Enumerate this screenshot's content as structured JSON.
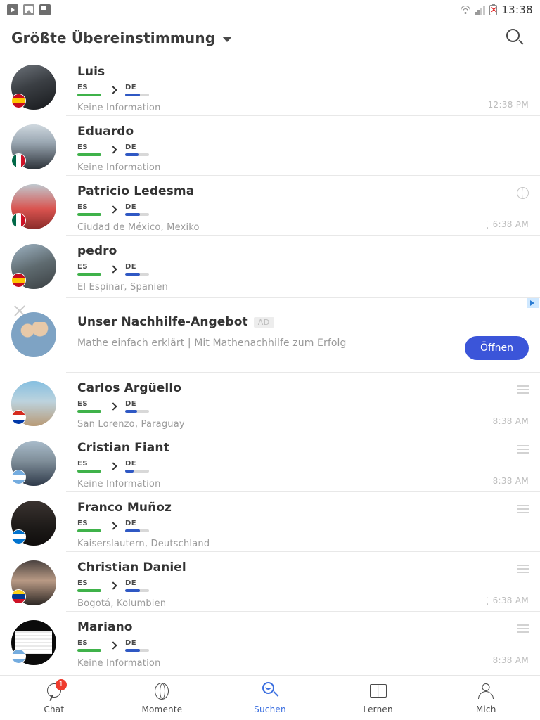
{
  "status_bar": {
    "time": "13:38",
    "left_icons": [
      "video-notification-icon",
      "image-notification-icon",
      "flag-notification-icon"
    ],
    "right_icons": [
      "wifi-icon",
      "signal-icon",
      "battery-error-icon"
    ]
  },
  "header": {
    "title": "Größte Übereinstimmung",
    "dropdown_icon": "chevron-down-icon",
    "search_icon": "search-icon"
  },
  "rows": [
    {
      "name": "Luis",
      "native": "ES",
      "native_pct": 100,
      "learning": "DE",
      "learning_pct": 62,
      "location": "Keine Information",
      "time": "12:38 PM",
      "flag": "es",
      "avatar": "ph-car",
      "hamburger": false,
      "moon": false,
      "globe": false
    },
    {
      "name": "Eduardo",
      "native": "ES",
      "native_pct": 100,
      "learning": "DE",
      "learning_pct": 55,
      "location": "Keine Information",
      "time": "",
      "flag": "mx",
      "avatar": "ph-ski",
      "hamburger": false,
      "moon": false,
      "globe": false
    },
    {
      "name": "Patricio Ledesma",
      "native": "ES",
      "native_pct": 100,
      "learning": "DE",
      "learning_pct": 62,
      "location": "Ciudad de México, Mexiko",
      "time": "6:38 AM",
      "flag": "mx",
      "avatar": "ph-red",
      "hamburger": false,
      "moon": true,
      "globe": true
    },
    {
      "name": "pedro",
      "native": "ES",
      "native_pct": 100,
      "learning": "DE",
      "learning_pct": 62,
      "location": "El Espinar, Spanien",
      "time": "",
      "flag": "es",
      "avatar": "ph-win",
      "hamburger": false,
      "moon": false,
      "globe": false
    }
  ],
  "ad": {
    "title": "Unser Nachhilfe-Angebot",
    "badge": "AD",
    "description": "Mathe einfach erklärt | Mit Mathenachhilfe zum Erfolg",
    "cta_label": "Öffnen",
    "close_icon": "close-icon",
    "adchoices_icon": "ad-choices-icon",
    "cta_color": "#3b55d9"
  },
  "rows2": [
    {
      "name": "Carlos Argüello",
      "native": "ES",
      "native_pct": 100,
      "learning": "DE",
      "learning_pct": 50,
      "location": "San Lorenzo, Paraguay",
      "time": "8:38 AM",
      "flag": "py",
      "avatar": "ph-sea",
      "hamburger": true,
      "moon": false,
      "globe": false
    },
    {
      "name": "Cristian Fiant",
      "native": "ES",
      "native_pct": 100,
      "learning": "DE",
      "learning_pct": 35,
      "location": "Keine Information",
      "time": "8:38 AM",
      "flag": "ar",
      "avatar": "ph-gate",
      "hamburger": true,
      "moon": false,
      "globe": false
    },
    {
      "name": "Franco Muñoz",
      "native": "ES",
      "native_pct": 100,
      "learning": "DE",
      "learning_pct": 62,
      "location": "Kaiserslautern, Deutschland",
      "time": "",
      "flag": "hn",
      "avatar": "ph-drk",
      "hamburger": true,
      "moon": false,
      "globe": false
    },
    {
      "name": "Christian Daniel",
      "native": "ES",
      "native_pct": 100,
      "learning": "DE",
      "learning_pct": 62,
      "location": "Bogotá, Kolumbien",
      "time": "6:38 AM",
      "flag": "co",
      "avatar": "ph-man",
      "hamburger": true,
      "moon": true,
      "globe": false
    },
    {
      "name": "Mariano",
      "native": "ES",
      "native_pct": 100,
      "learning": "DE",
      "learning_pct": 62,
      "location": "Keine Information",
      "time": "8:38 AM",
      "flag": "ar",
      "avatar": "ph-news",
      "hamburger": true,
      "moon": false,
      "globe": false
    }
  ],
  "bottom_nav": {
    "items": [
      {
        "label": "Chat",
        "icon": "chat-bubble-icon",
        "badge": "1",
        "active": false
      },
      {
        "label": "Momente",
        "icon": "globe-icon",
        "badge": "",
        "active": false
      },
      {
        "label": "Suchen",
        "icon": "search-icon",
        "badge": "",
        "active": true
      },
      {
        "label": "Lernen",
        "icon": "book-icon",
        "badge": "",
        "active": false
      },
      {
        "label": "Mich",
        "icon": "person-icon",
        "badge": "",
        "active": false
      }
    ],
    "active_color": "#3b6fe0"
  },
  "colors": {
    "native_bar": "#3fb24a",
    "learning_bar": "#2f58c4",
    "track": "#d8d8d8",
    "badge_red": "#ef3b2d"
  }
}
